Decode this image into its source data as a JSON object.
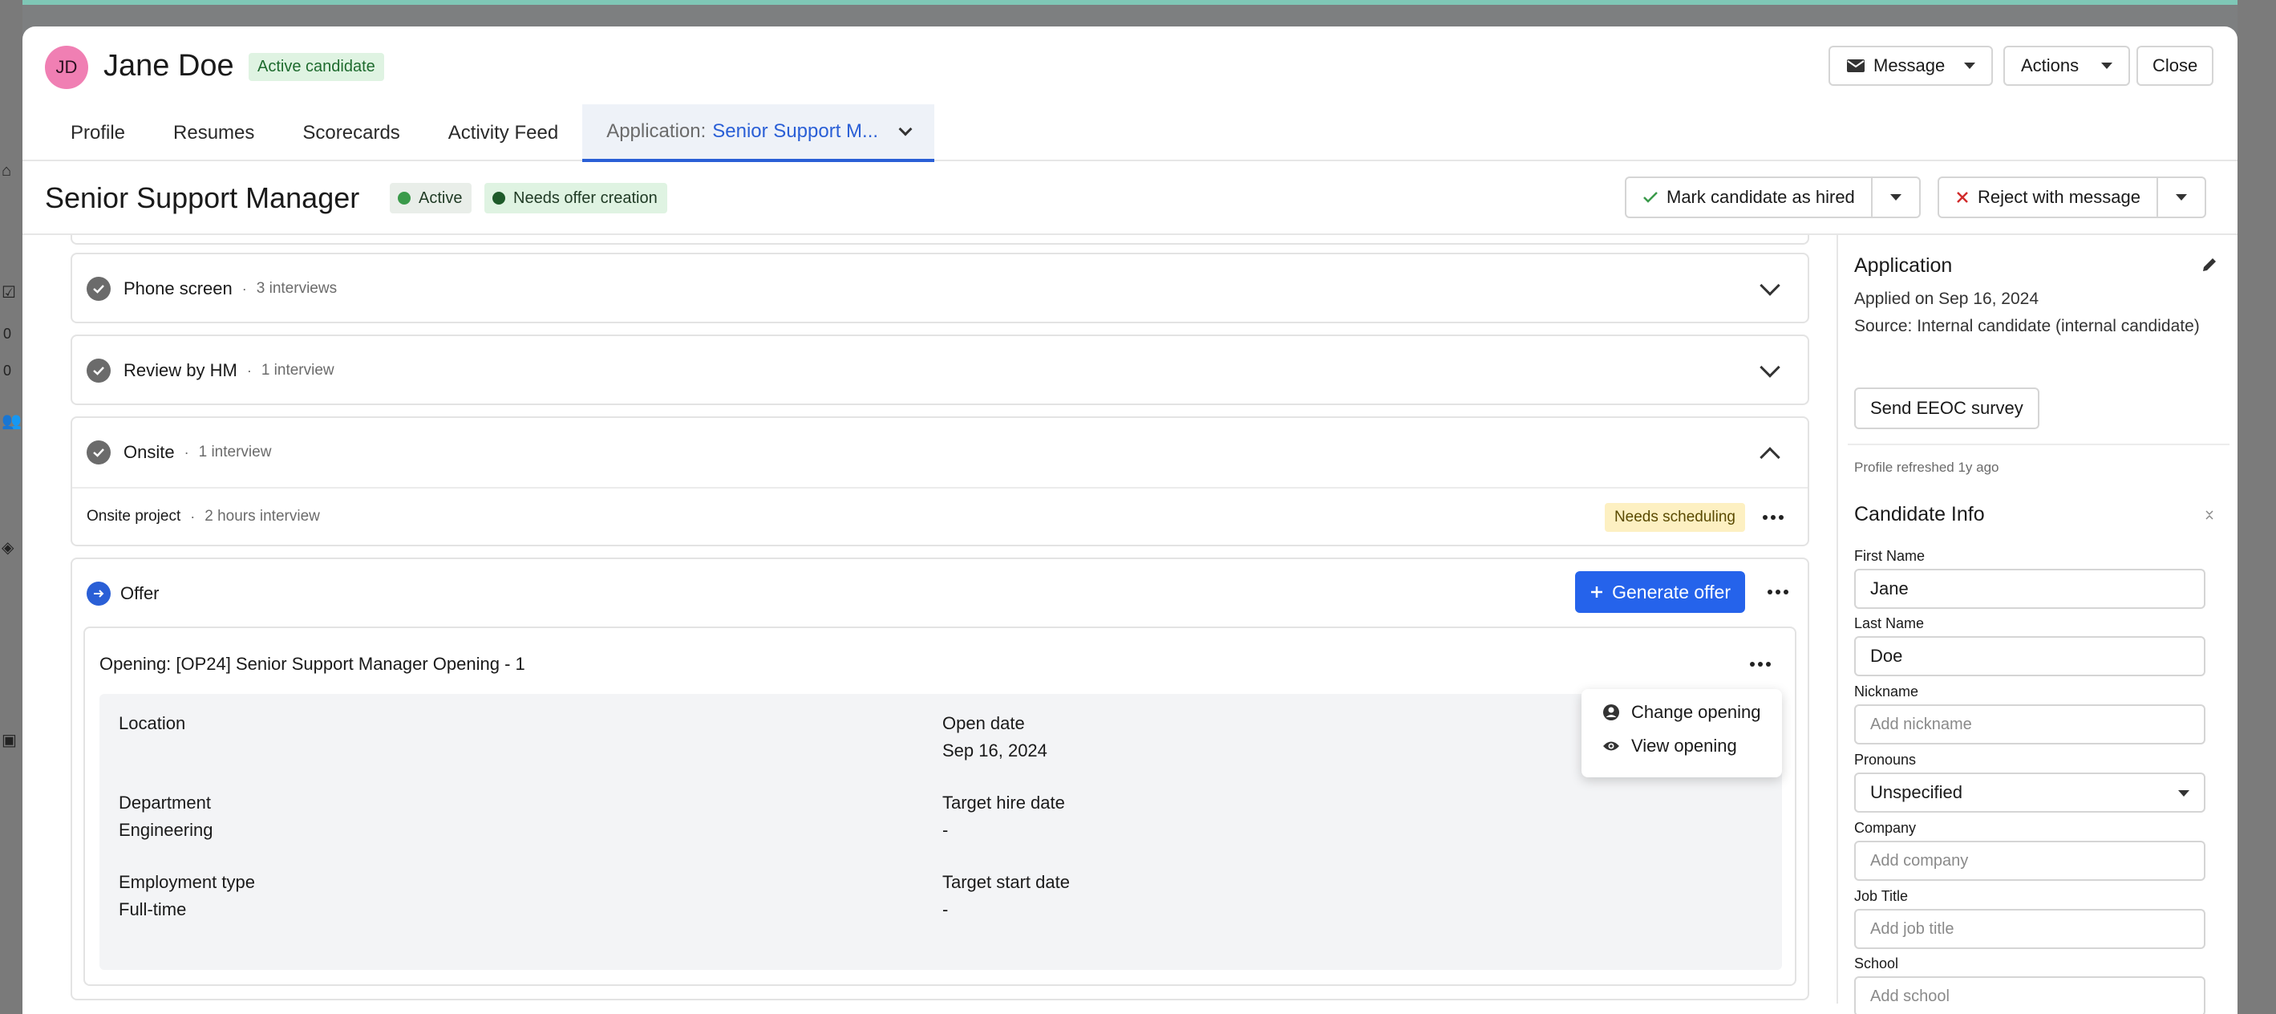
{
  "candidate": {
    "initials": "JD",
    "name": "Jane Doe",
    "status_badge": "Active candidate"
  },
  "header_actions": {
    "message": "Message",
    "actions": "Actions",
    "close": "Close"
  },
  "tabs": {
    "profile": "Profile",
    "resumes": "Resumes",
    "scorecards": "Scorecards",
    "activity": "Activity Feed",
    "application_prefix": "Application:",
    "application_job": "Senior Support M..."
  },
  "job": {
    "title": "Senior Support Manager",
    "status": "Active",
    "stage_status": "Needs offer creation",
    "hire_label": "Mark candidate as hired",
    "reject_label": "Reject with message"
  },
  "stages": {
    "phone_screen": {
      "name": "Phone screen",
      "meta": "3 interviews"
    },
    "review_hm": {
      "name": "Review by HM",
      "meta": "1 interview"
    },
    "onsite": {
      "name": "Onsite",
      "meta": "1 interview",
      "interview_name": "Onsite project",
      "interview_meta": "2 hours interview",
      "interview_status": "Needs scheduling"
    },
    "offer": {
      "name": "Offer",
      "generate_label": "Generate offer",
      "opening_title": "Opening: [OP24] Senior Support Manager Opening - 1",
      "fields": {
        "location_label": "Location",
        "location_value": "",
        "open_date_label": "Open date",
        "open_date_value": "Sep 16, 2024",
        "department_label": "Department",
        "department_value": "Engineering",
        "target_hire_label": "Target hire date",
        "target_hire_value": "-",
        "employment_label": "Employment type",
        "employment_value": "Full-time",
        "target_start_label": "Target start date",
        "target_start_value": "-"
      }
    }
  },
  "opening_menu": {
    "change": "Change opening",
    "view": "View opening"
  },
  "application": {
    "title": "Application",
    "applied": "Applied on Sep 16, 2024",
    "source": "Source: Internal candidate (internal candidate)",
    "eeoc": "Send EEOC survey",
    "refreshed": "Profile refreshed 1y ago"
  },
  "candidate_info": {
    "title": "Candidate Info",
    "first_name_label": "First Name",
    "first_name_value": "Jane",
    "last_name_label": "Last Name",
    "last_name_value": "Doe",
    "nickname_label": "Nickname",
    "nickname_placeholder": "Add nickname",
    "pronouns_label": "Pronouns",
    "pronouns_value": "Unspecified",
    "company_label": "Company",
    "company_placeholder": "Add company",
    "job_title_label": "Job Title",
    "job_title_placeholder": "Add job title",
    "school_label": "School",
    "school_placeholder": "Add school"
  },
  "backdrop": {
    "count_a": "0",
    "count_b": "0"
  },
  "colors": {
    "accent": "#2563eb",
    "avatar": "#f07fb3",
    "success": "#3a9a4a",
    "warning_bg": "#fdf0c2"
  }
}
